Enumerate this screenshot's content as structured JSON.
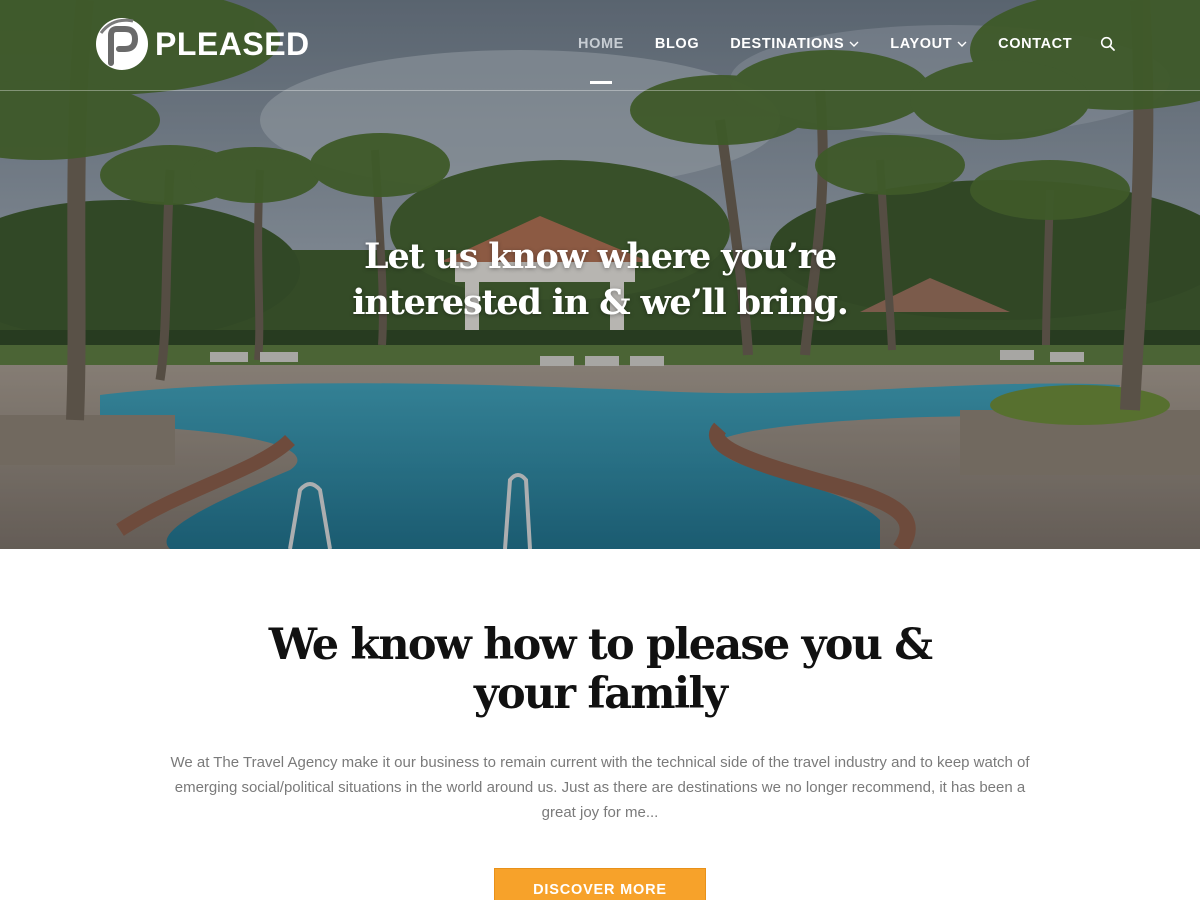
{
  "brand": {
    "logo_icon": "pleased-p-logo-icon",
    "name": "PLEASED"
  },
  "nav": {
    "items": [
      {
        "label": "HOME",
        "active": true,
        "has_dropdown": false
      },
      {
        "label": "BLOG",
        "active": false,
        "has_dropdown": false
      },
      {
        "label": "DESTINATIONS",
        "active": false,
        "has_dropdown": true
      },
      {
        "label": "LAYOUT",
        "active": false,
        "has_dropdown": true
      },
      {
        "label": "CONTACT",
        "active": false,
        "has_dropdown": false
      }
    ],
    "search_icon": "search-icon",
    "dropdown_icon": "chevron-down-icon"
  },
  "hero": {
    "title": "Let us know where you’re interested in & we’ll bring.",
    "image": "resort-pool-with-palm-trees"
  },
  "intro": {
    "heading": "We know how to please you & your family",
    "text": "We at The Travel Agency make it our business to remain current with the technical side of the travel industry and to keep watch of emerging social/political situations in the world around us. Just as there are destinations we no longer recommend, it has been a great joy for me...",
    "button_label": "DISCOVER MORE"
  },
  "colors": {
    "accent": "#f7a22a",
    "heading": "#111111",
    "body_text": "#7a7a7a"
  }
}
